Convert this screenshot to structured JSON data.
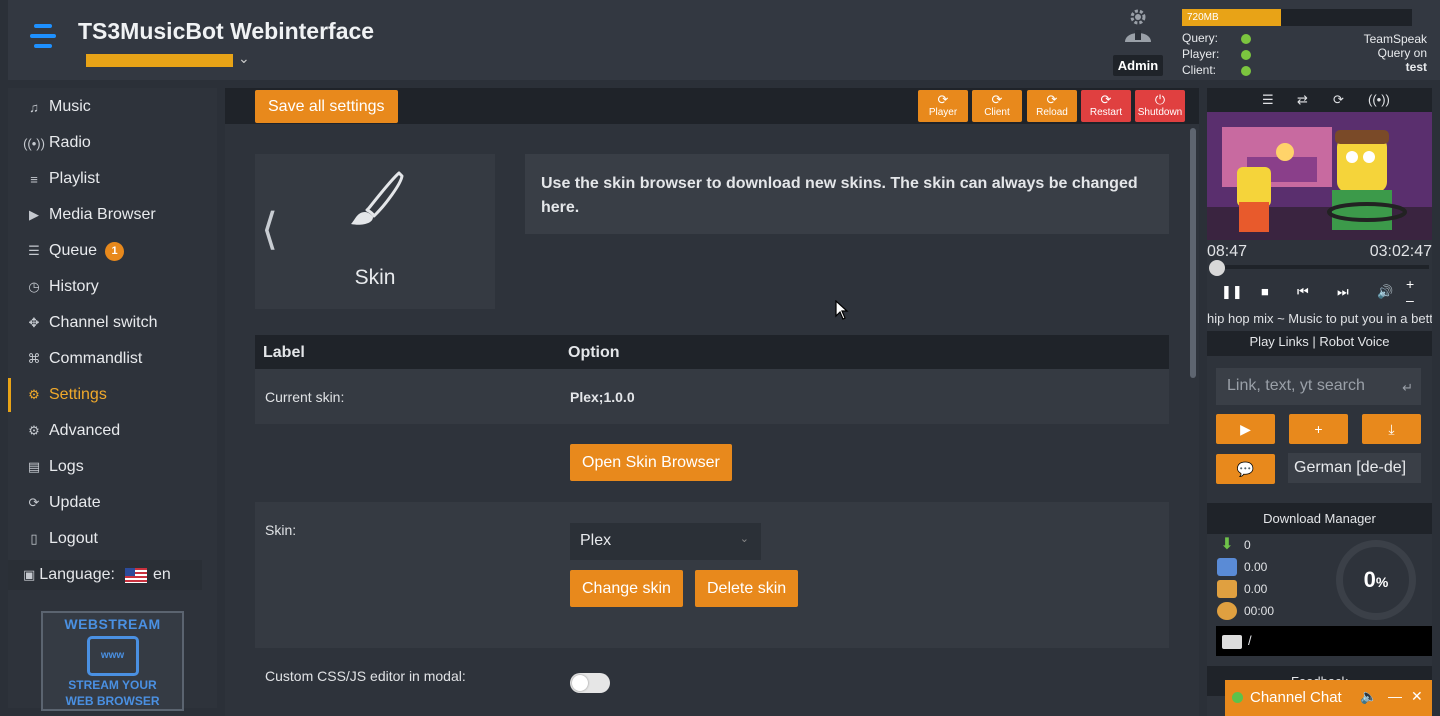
{
  "app": {
    "title": "TS3MusicBot Webinterface"
  },
  "header": {
    "admin_label": "Admin",
    "memory": {
      "label": "720MB",
      "fraction": 0.43
    },
    "status": [
      {
        "label": "Query:",
        "value": "TeamSpeak"
      },
      {
        "label": "Player:",
        "value": "Query on"
      },
      {
        "label": "Client:",
        "value": "test"
      }
    ],
    "status_color": "#7cc53f"
  },
  "sidebar": {
    "items": [
      {
        "label": "Music",
        "icon": "music-note-icon"
      },
      {
        "label": "Radio",
        "icon": "radio-waves-icon"
      },
      {
        "label": "Playlist",
        "icon": "playlist-icon"
      },
      {
        "label": "Media Browser",
        "icon": "youtube-icon"
      },
      {
        "label": "Queue",
        "icon": "list-icon",
        "badge": "1"
      },
      {
        "label": "History",
        "icon": "clock-icon"
      },
      {
        "label": "Channel switch",
        "icon": "move-arrows-icon"
      },
      {
        "label": "Commandlist",
        "icon": "command-icon"
      },
      {
        "label": "Settings",
        "icon": "gear-icon",
        "active": true
      },
      {
        "label": "Advanced",
        "icon": "gear-outline-icon"
      },
      {
        "label": "Logs",
        "icon": "document-icon"
      },
      {
        "label": "Update",
        "icon": "refresh-icon"
      },
      {
        "label": "Logout",
        "icon": "door-icon"
      }
    ],
    "language": {
      "label": "Language:",
      "value": "en"
    },
    "webstream": {
      "title": "WEBSTREAM",
      "icon_text": "www",
      "line1": "STREAM YOUR",
      "line2": "WEB BROWSER"
    }
  },
  "toolbar": {
    "save_label": "Save all settings",
    "buttons": [
      {
        "label": "Player",
        "color": "#e8891c"
      },
      {
        "label": "Client",
        "color": "#e8891c"
      },
      {
        "label": "Reload",
        "color": "#e8891c"
      },
      {
        "label": "Restart",
        "color": "#e04040"
      },
      {
        "label": "Shutdown",
        "color": "#e04040"
      }
    ]
  },
  "main": {
    "card_title": "Skin",
    "info_text": "Use the skin browser to download new skins. The skin can always be changed here.",
    "table": {
      "headers": [
        "Label",
        "Option"
      ],
      "current_skin_label": "Current skin:",
      "current_skin_value": "Plex;1.0.0",
      "open_browser_label": "Open Skin Browser",
      "skin_label": "Skin:",
      "skin_selected": "Plex",
      "change_label": "Change skin",
      "delete_label": "Delete skin",
      "custom_css_label": "Custom CSS/JS editor in modal:",
      "custom_css_enabled": false
    }
  },
  "player": {
    "elapsed": "08:47",
    "duration": "03:02:47",
    "track_title": "hip hop mix ~ Music to put you in a better mood",
    "links": "Play Links | Robot Voice",
    "search_placeholder": "Link, text, yt search",
    "language": "German [de-de]",
    "download": {
      "header": "Download Manager",
      "count": "0",
      "speed": "0.00",
      "size": "0.00",
      "time": "00:00",
      "percent": "0",
      "percent_sign": "%",
      "path": "/"
    },
    "feedback": "Feedback"
  },
  "chat": {
    "title": "Channel Chat"
  }
}
